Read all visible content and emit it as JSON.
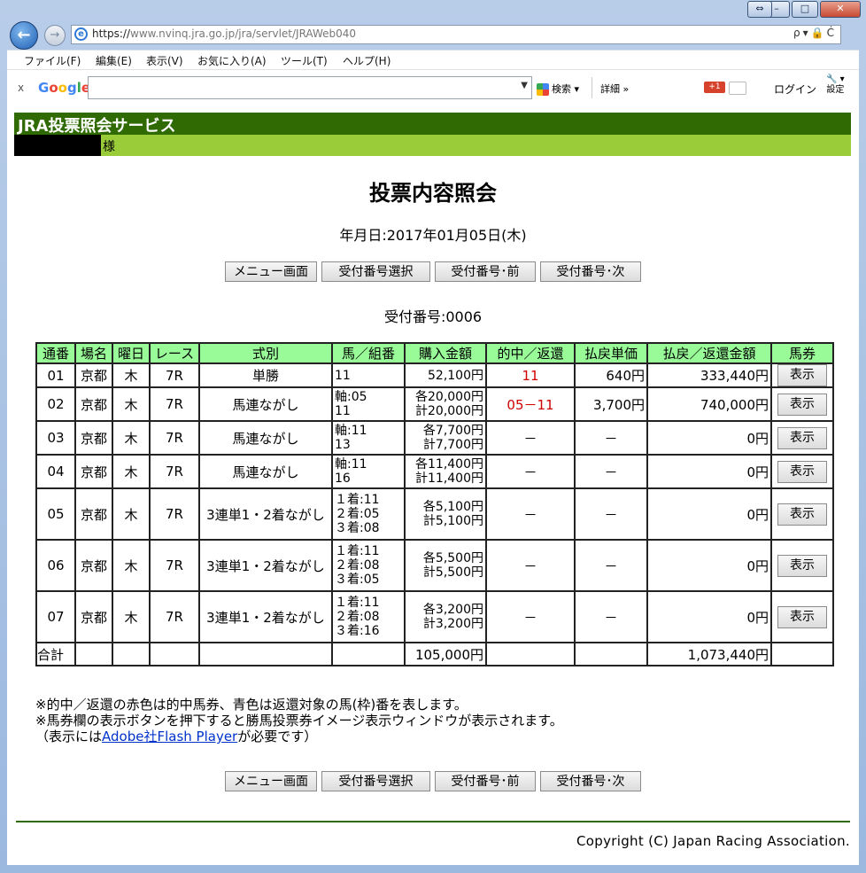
{
  "browser": {
    "url_prefix": "https://",
    "url_host": "www.nvinq.jra.go.jp",
    "url_path": "/jra/servlet/JRAWeb040",
    "addr_tools": "ρ▾🔒Ċ",
    "win_resize": "⇔",
    "win_min": "–",
    "win_max": "□",
    "win_close": "✕",
    "back_icon": "←",
    "fwd_icon": "→",
    "ie_icon": "e"
  },
  "menu": [
    "ファイル(F)",
    "編集(E)",
    "表示(V)",
    "お気に入り(A)",
    "ツール(T)",
    "ヘルプ(H)"
  ],
  "google_toolbar": {
    "close": "x",
    "logo": "Google",
    "search": "検索",
    "details": "詳細 »",
    "gplus": "+1",
    "login": "ログイン",
    "settings": "設定"
  },
  "page": {
    "service_name": "JRA投票照会サービス",
    "sama": "様",
    "title": "投票内容照会",
    "date": "年月日:2017年01月05日(木)",
    "buttons": [
      "メニュー画面",
      "受付番号選択",
      "受付番号･前",
      "受付番号･次"
    ],
    "receipt_no": "受付番号:0006",
    "table": {
      "headers": [
        "通番",
        "場名",
        "曜日",
        "レース",
        "式別",
        "馬／組番",
        "購入金額",
        "的中／返還",
        "払戻単価",
        "払戻／返還金額",
        "馬券"
      ],
      "rows": [
        {
          "no": "01",
          "venue": "京都",
          "day": "木",
          "race": "7R",
          "type": "単勝",
          "combo": [
            "11"
          ],
          "amount": [
            "52,100円"
          ],
          "hit": "11",
          "unit": "640円",
          "payout": "333,440円",
          "ticket": "表示"
        },
        {
          "no": "02",
          "venue": "京都",
          "day": "木",
          "race": "7R",
          "type": "馬連ながし",
          "combo": [
            "軸:05",
            "11"
          ],
          "amount": [
            "各20,000円",
            "計20,000円"
          ],
          "hit": "05－11",
          "unit": "3,700円",
          "payout": "740,000円",
          "ticket": "表示"
        },
        {
          "no": "03",
          "venue": "京都",
          "day": "木",
          "race": "7R",
          "type": "馬連ながし",
          "combo": [
            "軸:11",
            "13"
          ],
          "amount": [
            "各7,700円",
            "計7,700円"
          ],
          "hit": "－",
          "unit": "－",
          "payout": "0円",
          "ticket": "表示"
        },
        {
          "no": "04",
          "venue": "京都",
          "day": "木",
          "race": "7R",
          "type": "馬連ながし",
          "combo": [
            "軸:11",
            "16"
          ],
          "amount": [
            "各11,400円",
            "計11,400円"
          ],
          "hit": "－",
          "unit": "－",
          "payout": "0円",
          "ticket": "表示"
        },
        {
          "no": "05",
          "venue": "京都",
          "day": "木",
          "race": "7R",
          "type": "3連単1・2着ながし",
          "combo": [
            "１着:11",
            "２着:05",
            "３着:08"
          ],
          "amount": [
            "各5,100円",
            "計5,100円"
          ],
          "hit": "－",
          "unit": "－",
          "payout": "0円",
          "ticket": "表示"
        },
        {
          "no": "06",
          "venue": "京都",
          "day": "木",
          "race": "7R",
          "type": "3連単1・2着ながし",
          "combo": [
            "１着:11",
            "２着:08",
            "３着:05"
          ],
          "amount": [
            "各5,500円",
            "計5,500円"
          ],
          "hit": "－",
          "unit": "－",
          "payout": "0円",
          "ticket": "表示"
        },
        {
          "no": "07",
          "venue": "京都",
          "day": "木",
          "race": "7R",
          "type": "3連単1・2着ながし",
          "combo": [
            "１着:11",
            "２着:08",
            "３着:16"
          ],
          "amount": [
            "各3,200円",
            "計3,200円"
          ],
          "hit": "－",
          "unit": "－",
          "payout": "0円",
          "ticket": "表示"
        }
      ],
      "total_label": "合計",
      "total_amount": "105,000円",
      "total_payout": "1,073,440円"
    },
    "notes": [
      "※的中／返還の赤色は的中馬券、青色は返還対象の馬(枠)番を表します。",
      "※馬券欄の表示ボタンを押下すると勝馬投票券イメージ表示ウィンドウが表示されます。"
    ],
    "note3_pre": "（表示には",
    "note3_link": "Adobe社Flash Player",
    "note3_post": "が必要です）",
    "copyright": "Copyright (C) Japan Racing Association."
  },
  "colors": {
    "header_dark": "#2f6b02",
    "header_light": "#9acc3a",
    "table_header": "#98fb98",
    "hit_red": "#d00000"
  }
}
